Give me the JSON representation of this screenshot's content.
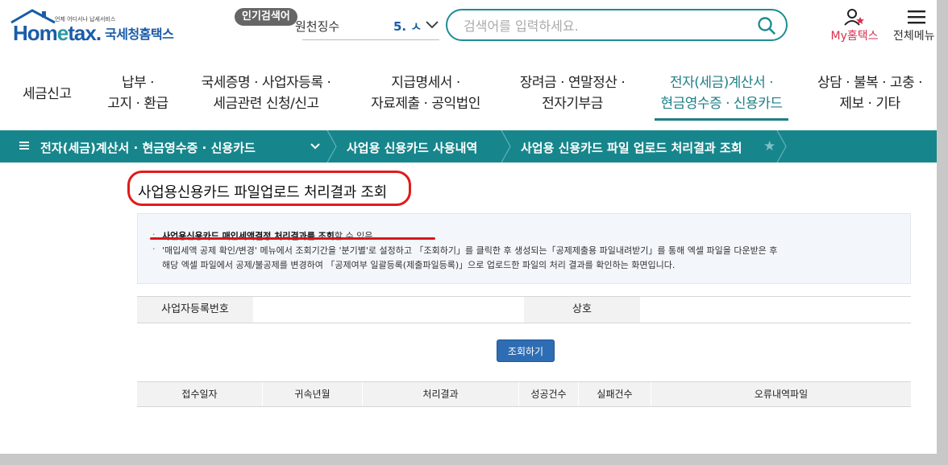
{
  "header": {
    "logo_tagline": "언제 어디서나 납세서비스",
    "logo_brand_home": "Hom",
    "logo_brand_e": "e",
    "logo_brand_tax": "tax.",
    "logo_name": "국세청홈택스",
    "popular_label": "인기검색어",
    "popular_keyword": "원천징수",
    "popular_rank": "5. ㅅ",
    "search_placeholder": "검색어를 입력하세요.",
    "my_hometax": "My홈택스",
    "all_menu": "전체메뉴"
  },
  "main_nav": [
    {
      "l1": "세금신고",
      "l2": ""
    },
    {
      "l1": "납부 ·",
      "l2": "고지 · 환급"
    },
    {
      "l1": "국세증명 · 사업자등록 ·",
      "l2": "세금관련 신청/신고"
    },
    {
      "l1": "지급명세서 ·",
      "l2": "자료제출 · 공익법인"
    },
    {
      "l1": "장려금 · 연말정산 ·",
      "l2": "전자기부금"
    },
    {
      "l1": "전자(세금)계산서 ·",
      "l2": "현금영수증 · 신용카드"
    },
    {
      "l1": "상담 · 불복 · 고충 ·",
      "l2": "제보 · 기타"
    }
  ],
  "breadcrumb": {
    "level1": "전자(세금)계산서 · 현금영수증 · 신용카드",
    "level2": "사업용 신용카드 사용내역",
    "level3": "사업용 신용카드 파일 업로드 처리결과 조회"
  },
  "page": {
    "title": "사업용신용카드 파일업로드 처리결과 조회",
    "info_bold": "사업용신용카드 매입세액결정 처리결과를 조회",
    "info_rest": "할 수 있음",
    "info_line2": "'매입세액 공제 확인/변경' 메뉴에서 조회기간을 '분기별'로 설정하고 「조회하기」를 클릭한 후 생성되는「공제제출용 파일내려받기」를 통해 엑셀 파일을 다운받은 후",
    "info_line3": "해당 엑셀 파일에서 공제/불공제를 변경하여 「공제여부 일괄등록(제출파일등록)」으로 업로드한 파일의 처리 결과를 확인하는 화면입니다."
  },
  "form": {
    "biz_no_label": "사업자등록번호",
    "company_label": "상호",
    "query_button": "조회하기"
  },
  "result_table": {
    "columns": [
      "접수일자",
      "귀속년월",
      "처리결과",
      "성공건수",
      "실패건수",
      "오류내역파일"
    ]
  },
  "colors": {
    "teal": "#17868c",
    "brand_blue": "#1a5ca8",
    "highlight_red": "#e01b1b"
  }
}
